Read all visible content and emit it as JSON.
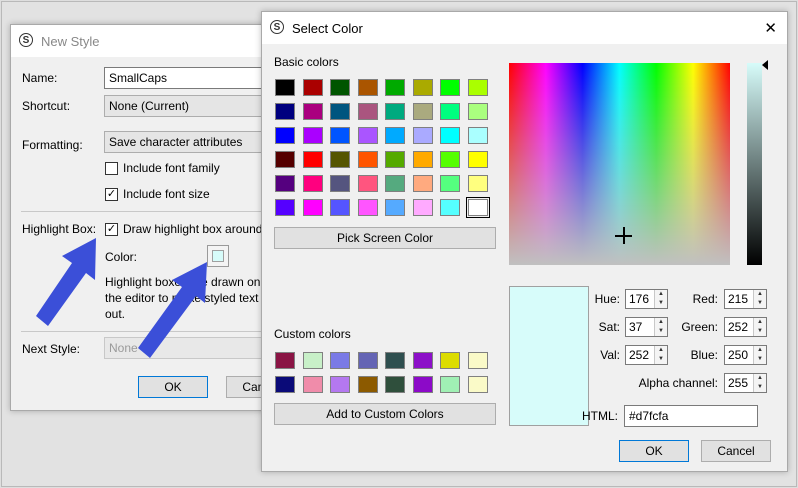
{
  "new_style": {
    "title": "New Style",
    "name_label": "Name:",
    "name_value": "SmallCaps",
    "shortcut_label": "Shortcut:",
    "shortcut_value": "None (Current)",
    "formatting_label": "Formatting:",
    "formatting_value": "Save character attributes",
    "include_font_family": "Include font family",
    "include_font_size": "Include font size",
    "highlight_box_label": "Highlight Box:",
    "draw_highlight_box": "Draw highlight box around",
    "color_label": "Color:",
    "highlight_desc_1": "Highlight boxes are drawn onl",
    "highlight_desc_2": "the editor to make styled text",
    "highlight_desc_3": "out.",
    "next_style_label": "Next Style:",
    "next_style_value": "None",
    "ok_label": "OK",
    "cancel_label": "Cancel"
  },
  "select_color": {
    "title": "Select Color",
    "close_glyph": "✕",
    "basic_colors_label": "Basic colors",
    "basic_colors": [
      "#000000",
      "#aa0000",
      "#005500",
      "#aa5500",
      "#00aa00",
      "#aaaa00",
      "#00ff00",
      "#aaff00",
      "#00007f",
      "#aa007f",
      "#00557f",
      "#aa557f",
      "#00aa7f",
      "#aaaa7f",
      "#00ff7f",
      "#aaff7f",
      "#0000ff",
      "#aa00ff",
      "#0055ff",
      "#aa55ff",
      "#00aaff",
      "#aaaaff",
      "#00ffff",
      "#aaffff",
      "#550000",
      "#ff0000",
      "#555500",
      "#ff5500",
      "#55aa00",
      "#ffaa00",
      "#55ff00",
      "#ffff00",
      "#55007f",
      "#ff007f",
      "#55557f",
      "#ff557f",
      "#55aa7f",
      "#ffaa7f",
      "#55ff7f",
      "#ffff7f",
      "#5500ff",
      "#ff00ff",
      "#5555ff",
      "#ff55ff",
      "#55aaff",
      "#ffaaff",
      "#55ffff",
      "#ffffff"
    ],
    "pick_screen_color": "Pick Screen Color",
    "custom_colors_label": "Custom colors",
    "custom_colors": [
      "#8a1444",
      "#c8f0c8",
      "#7a7ae6",
      "#6464b4",
      "#2f4f4f",
      "#8c10c8",
      "#dcdc00",
      "#fafac8",
      "#0a0a78",
      "#f08caa",
      "#b478f0",
      "#8c5a00",
      "#2f4f3c",
      "#8c0ac8",
      "#a0f0b4",
      "#fafac8"
    ],
    "add_custom": "Add to Custom Colors",
    "hue_label": "Hue:",
    "hue_value": "176",
    "sat_label": "Sat:",
    "sat_value": "37",
    "val_label": "Val:",
    "val_value": "252",
    "red_label": "Red:",
    "red_value": "215",
    "green_label": "Green:",
    "green_value": "252",
    "blue_label": "Blue:",
    "blue_value": "250",
    "alpha_label": "Alpha channel:",
    "alpha_value": "255",
    "html_label": "HTML:",
    "html_value": "#d7fcfa",
    "current_color": "#d7fcfa",
    "ok_label": "OK",
    "cancel_label": "Cancel"
  },
  "arrow_color": "#3b4fd8"
}
